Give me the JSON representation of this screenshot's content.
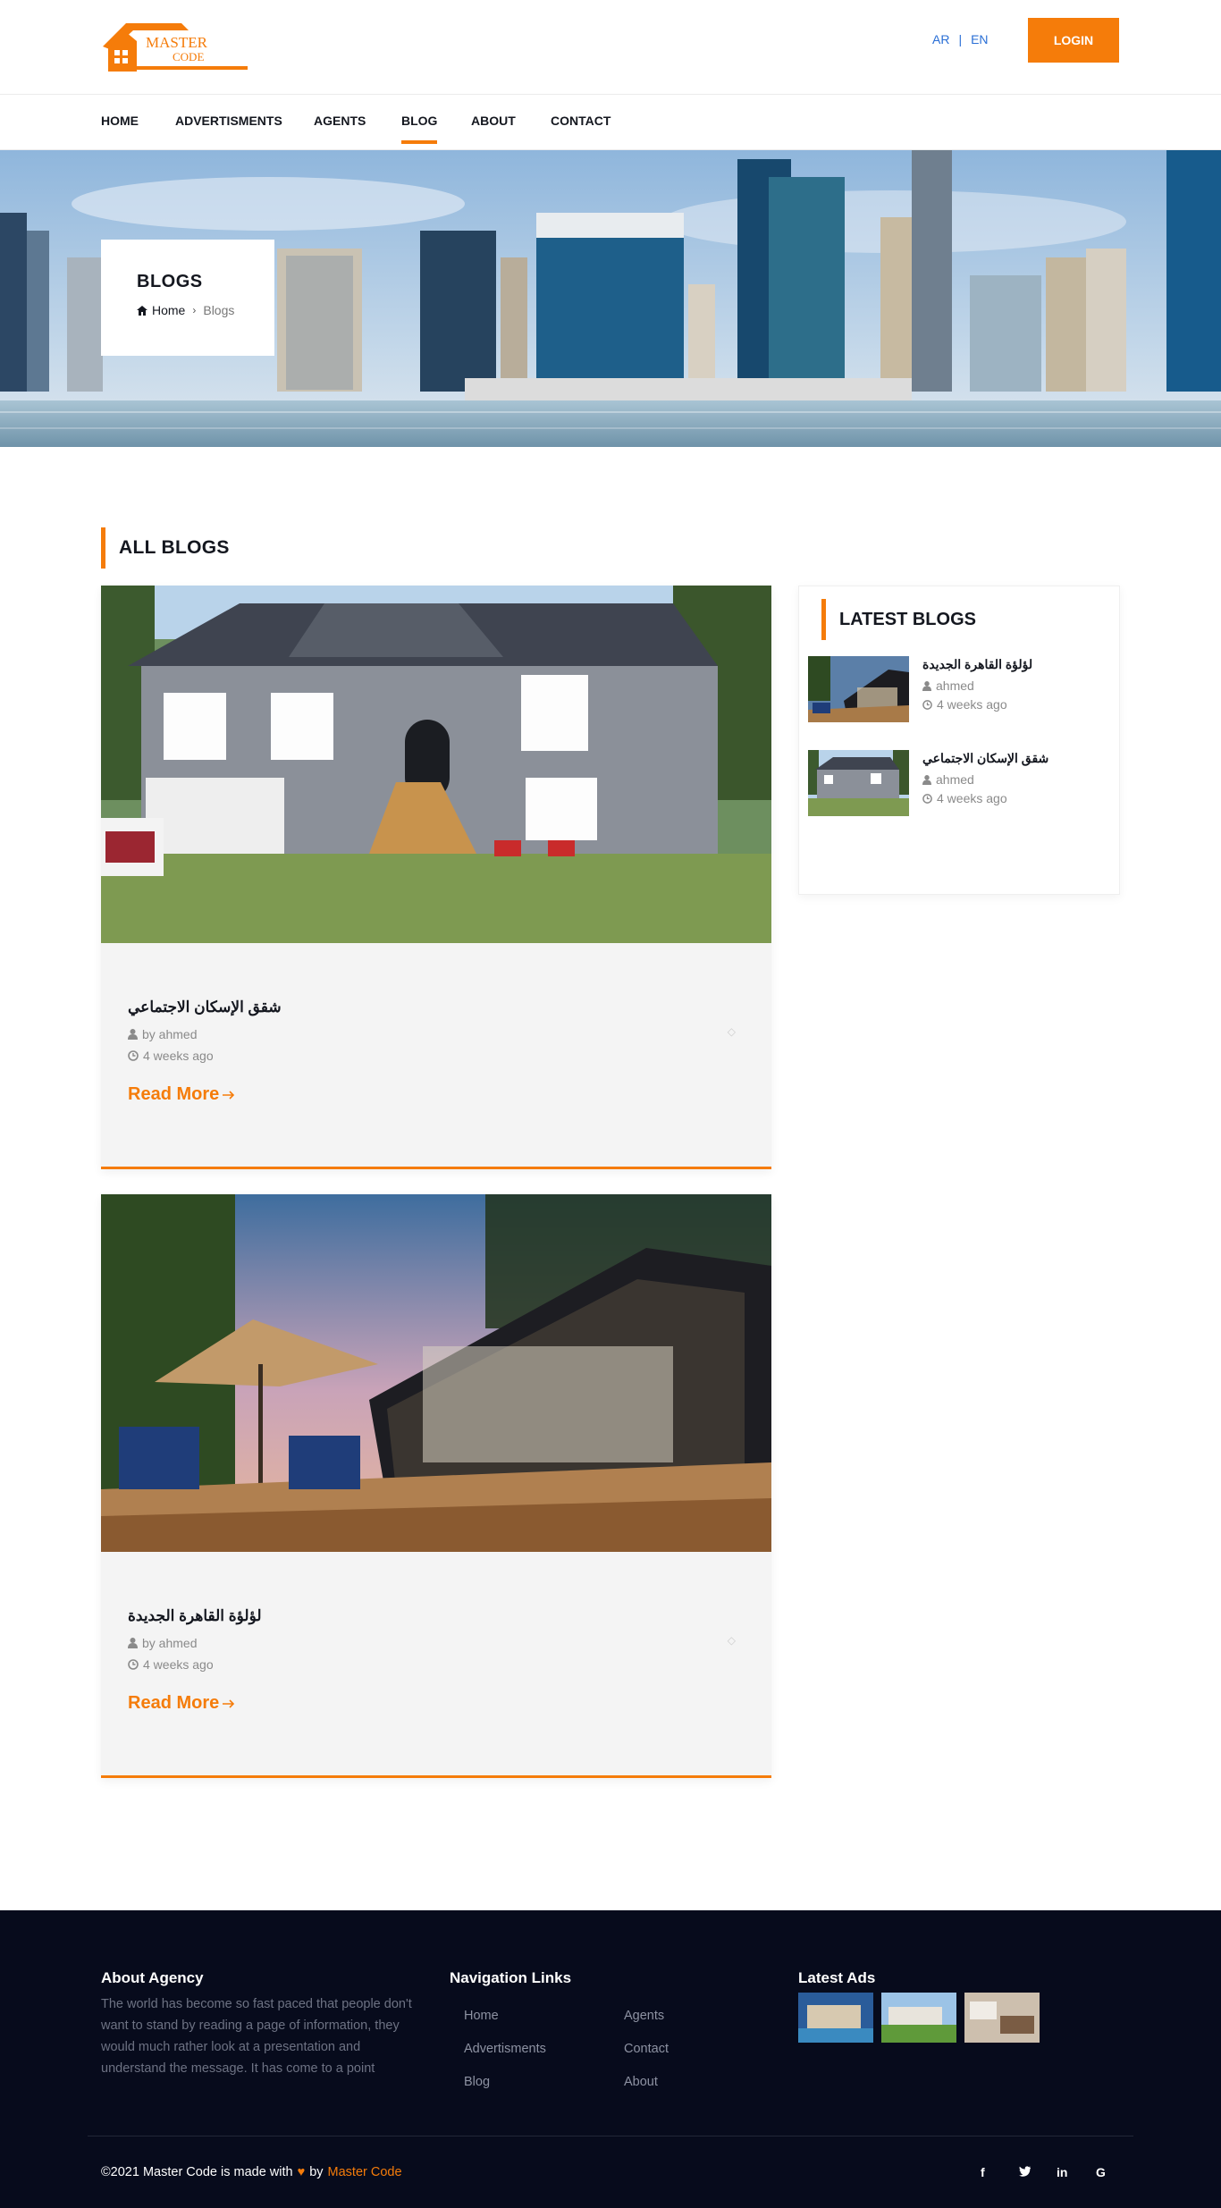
{
  "header": {
    "logo": {
      "line1": "MASTER",
      "line2": "CODE"
    },
    "lang": {
      "ar": "AR",
      "sep": "|",
      "en": "EN"
    },
    "login_label": "LOGIN"
  },
  "nav": {
    "items": [
      {
        "label": "HOME"
      },
      {
        "label": "ADVERTISMENTS"
      },
      {
        "label": "AGENTS"
      },
      {
        "label": "BLOG"
      },
      {
        "label": "ABOUT"
      },
      {
        "label": "CONTACT"
      }
    ],
    "active": "BLOG"
  },
  "hero": {
    "title": "BLOGS",
    "breadcrumb_home": "Home",
    "breadcrumb_sep": "›",
    "breadcrumb_current": "Blogs"
  },
  "section": {
    "title": "ALL BLOGS"
  },
  "posts": [
    {
      "title": "شقق الإسكان الاجتماعي",
      "author": "by ahmed",
      "time": "4 weeks ago",
      "read_more": "Read More",
      "image": "house-photo"
    },
    {
      "title": "لؤلؤة القاهرة الجديدة",
      "author": "by ahmed",
      "time": "4 weeks ago",
      "read_more": "Read More",
      "image": "container-house-photo"
    }
  ],
  "sidebar": {
    "title": "LATEST BLOGS",
    "posts": [
      {
        "title": "لؤلؤة القاهرة الجديدة",
        "author": "ahmed",
        "time": "4 weeks ago"
      },
      {
        "title": "شقق الإسكان الاجتماعي",
        "author": "ahmed",
        "time": "4 weeks ago"
      }
    ]
  },
  "footer": {
    "about_title": "About Agency",
    "about_text": "The world has become so fast paced that people don't want to stand by reading a page of information, they would much rather look at a presentation and understand the message. It has come to a point",
    "nav_title": "Navigation Links",
    "nav_links": [
      "Home",
      "Agents",
      "Advertisments",
      "Contact",
      "Blog",
      "About"
    ],
    "ads_title": "Latest Ads",
    "copyright_prefix": "©2021 Master Code is made with",
    "copyright_by": "by",
    "copyright_brand": "Master Code",
    "social": [
      "facebook-icon",
      "twitter-icon",
      "linkedin-icon",
      "google-icon"
    ]
  },
  "colors": {
    "accent": "#f57c0a",
    "footer_bg": "#070b1c",
    "link_blue": "#2a6fd6"
  }
}
